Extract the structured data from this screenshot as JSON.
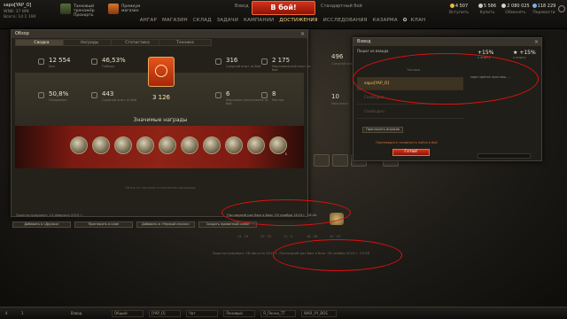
{
  "topbar": {
    "player_name": "sapo[YAP_O]",
    "player_sub": "WN8: 37 WN",
    "player_sub2": "Всего: 14 1 190",
    "training": {
      "label_1": "Танковый тренажёр",
      "label_2": "Прохорть"
    },
    "shop": {
      "label_1": "Премиум",
      "label_2": "магазин"
    },
    "platoon_label": "Взвод",
    "battle_label": "В бой!",
    "mode_label": "Стандартный бой",
    "menu": [
      {
        "label": "АНГАР"
      },
      {
        "label": "МАГАЗИН"
      },
      {
        "label": "СКЛАД"
      },
      {
        "label": "ЗАДАЧИ"
      },
      {
        "label": "КАМПАНИИ"
      },
      {
        "label": "ДОСТИЖЕНИЯ"
      },
      {
        "label": "ИССЛЕДОВАНИЯ"
      },
      {
        "label": "КАЗАРМА"
      },
      {
        "label": "КЛАН"
      }
    ],
    "resources": [
      {
        "value": "4 507",
        "label": "Вступить",
        "color": "#e8b93f"
      },
      {
        "value": "5 586",
        "label": "Купить",
        "color": "#c9c9c9"
      },
      {
        "value": "2 080 025",
        "label": "Обменять",
        "color": "#d5d0c0"
      },
      {
        "value": "118 229",
        "label": "Перевести",
        "color": "#7ab0e0"
      }
    ]
  },
  "profile": {
    "title": "Обзор",
    "close": "×",
    "tabs": [
      {
        "label": "Сводка"
      },
      {
        "label": "Награды"
      },
      {
        "label": "Статистика"
      },
      {
        "label": "Техника"
      }
    ],
    "stats_left": [
      {
        "value": "12 554",
        "label": "Бои"
      },
      {
        "value": "46,53%",
        "label": "Победы"
      },
      {
        "value": "50,8%",
        "label": "Попадания"
      },
      {
        "value": "443",
        "label": "Средний опыт за бой"
      }
    ],
    "stats_right": [
      {
        "value": "316",
        "label": "Средний опыт за бой"
      },
      {
        "value": "2 175",
        "label": "Максимальный опыт за бой"
      },
      {
        "value": "6",
        "label": "Максимум уничтожено за бой"
      },
      {
        "value": "8",
        "label": "Мастер"
      }
    ],
    "rating": "3 126",
    "awards_title": "Значимые награды",
    "medals": [
      "",
      "",
      "",
      "",
      "",
      "",
      "",
      "",
      "",
      "1"
    ],
    "awards_note": "Облик не настроен в плаченных фракциях",
    "registered": "Зарегистрирован: 14 февраля 2015 г.",
    "last_battle": "Последний раз был в бою: 29 ноября 2019 г. 18:44"
  },
  "actions": [
    {
      "label": "Добавить в «Друзья»"
    },
    {
      "label": "Пригласить в клан"
    },
    {
      "label": "Добавить в «Черный список»"
    },
    {
      "label": "Создать приватный канал"
    }
  ],
  "background": {
    "side_stats": [
      {
        "value": "496",
        "label": "Средний опыт"
      },
      {
        "value": "10",
        "label": "Максимум"
      }
    ],
    "carousel_nums": [
      "14 · 29",
      "23 · 32",
      "11 · 0",
      "18 · 28",
      "10 · 24"
    ],
    "last_battle_2": "Зарегистрирован: 28 августа 2014 г.   Последний раз был в бою: 26 ноября 2019 г. 23:28"
  },
  "platoon": {
    "title": "Взвод",
    "close": "×",
    "invite_label": "Пошаг из взвода",
    "bonus_xp": {
      "value": "+15%",
      "label": "к опыту"
    },
    "bonus_credit": {
      "value": "+15%",
      "label": "к опыту"
    },
    "col_player": "Техника",
    "col_vehicle": "Техника",
    "slots": [
      {
        "label": "sapo[YAP_O]"
      },
      {
        "label": "Свободно"
      },
      {
        "label": "Свободно"
      }
    ],
    "chat_text": "sapo принял приглаш. ..",
    "invite_button": "Пригласить игроков",
    "ready_text": "Подтвердите готовность найти в бой",
    "ready_button": "Готов!"
  },
  "taskbar": {
    "items": [
      "4",
      "1",
      "Взвод",
      "Общий",
      "[YAP_O]",
      "Чат",
      "Ленивый",
      "Я_Ленна_ТТ",
      "WAR_VY_BOS"
    ]
  }
}
